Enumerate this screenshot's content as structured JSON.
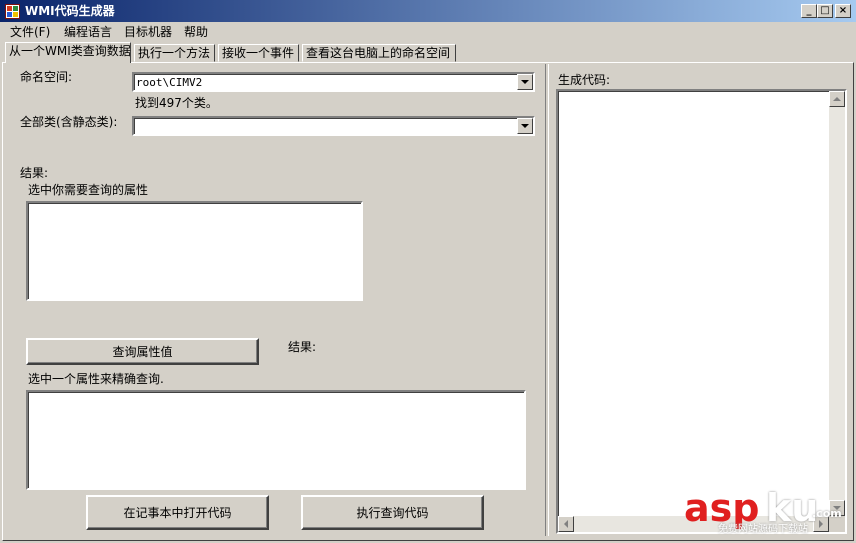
{
  "window": {
    "title": "WMI代码生成器"
  },
  "menu": {
    "items": [
      "文件(F)",
      "编程语言",
      "目标机器",
      "帮助"
    ]
  },
  "tabs": [
    {
      "label": "从一个WMI类查询数据",
      "active": true
    },
    {
      "label": "执行一个方法"
    },
    {
      "label": "接收一个事件"
    },
    {
      "label": "查看这台电脑上的命名空间"
    }
  ],
  "query": {
    "namespace_label": "命名空间:",
    "namespace_value": "root\\CIMV2",
    "found_text": "找到497个类。",
    "class_label": "全部类(含静态类):",
    "class_value": "",
    "results_label": "结果:",
    "properties_hint": "选中你需要查询的属性",
    "query_values_button": "查询属性值",
    "results_label_2": "结果:",
    "refine_hint": "选中一个属性来精确查询.",
    "open_notepad_button": "在记事本中打开代码",
    "run_code_button": "执行查询代码"
  },
  "code_panel": {
    "label": "生成代码:"
  },
  "watermark": {
    "brand_a": "asp",
    "brand_b": "ku",
    "brand_suffix": ".com",
    "tagline": "免费网站源码下载站"
  }
}
